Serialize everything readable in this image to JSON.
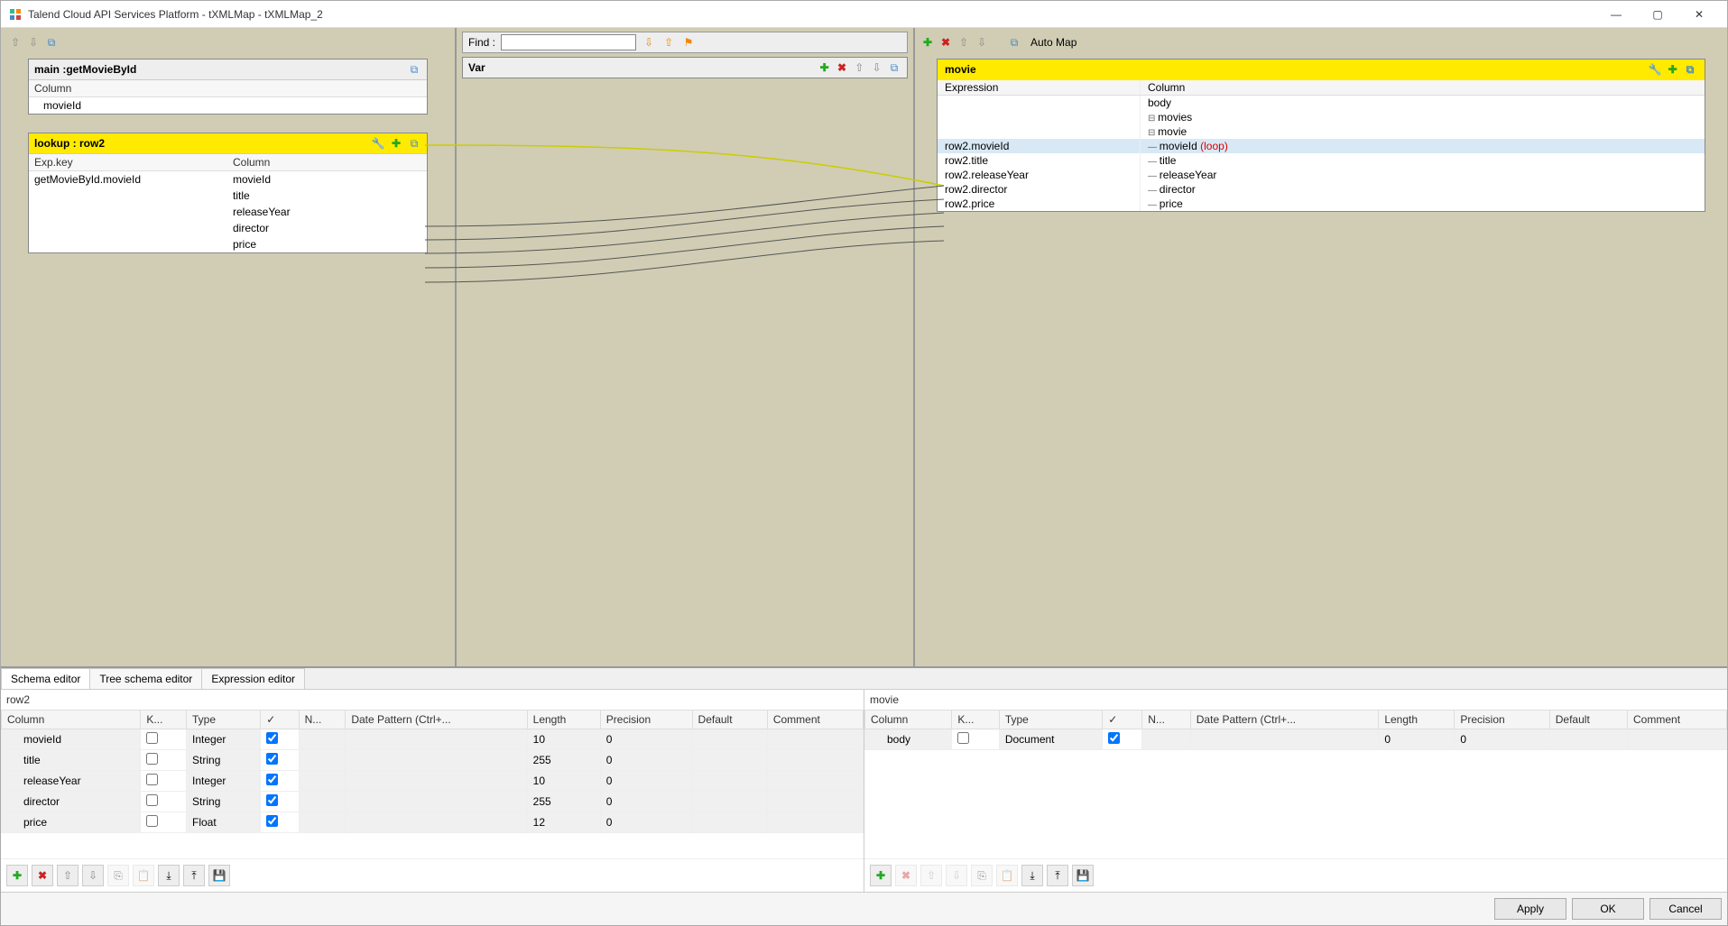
{
  "window": {
    "title": "Talend Cloud API Services Platform - tXMLMap - tXMLMap_2"
  },
  "find": {
    "label": "Find :"
  },
  "var": {
    "title": "Var"
  },
  "mainPanel": {
    "title": "main :getMovieById",
    "colHeader": "Column",
    "rows": [
      "movieId"
    ]
  },
  "lookupPanel": {
    "title": "lookup : row2",
    "expHeader": "Exp.key",
    "colHeader": "Column",
    "rows": [
      {
        "exp": "getMovieById.movieId",
        "col": "movieId"
      },
      {
        "exp": "",
        "col": "title"
      },
      {
        "exp": "",
        "col": "releaseYear"
      },
      {
        "exp": "",
        "col": "director"
      },
      {
        "exp": "",
        "col": "price"
      }
    ]
  },
  "rightToolbar": {
    "autoMap": "Auto Map"
  },
  "output": {
    "title": "movie",
    "expHeader": "Expression",
    "colHeader": "Column",
    "tree": [
      {
        "exp": "",
        "label": "body",
        "indent": 1,
        "type": "plain"
      },
      {
        "exp": "",
        "label": "movies",
        "indent": 2,
        "type": "node"
      },
      {
        "exp": "",
        "label": "movie",
        "indent": 3,
        "type": "node"
      },
      {
        "exp": "row2.movieId",
        "label": "movieId",
        "indent": 4,
        "type": "leaf",
        "loop": "(loop)",
        "sel": true
      },
      {
        "exp": "row2.title",
        "label": "title",
        "indent": 4,
        "type": "leaf"
      },
      {
        "exp": "row2.releaseYear",
        "label": "releaseYear",
        "indent": 4,
        "type": "leaf"
      },
      {
        "exp": "row2.director",
        "label": "director",
        "indent": 4,
        "type": "leaf"
      },
      {
        "exp": "row2.price",
        "label": "price",
        "indent": 4,
        "type": "leaf"
      }
    ]
  },
  "bottomTabs": [
    "Schema editor",
    "Tree schema editor",
    "Expression editor"
  ],
  "schemaLeft": {
    "title": "row2",
    "headers": [
      "Column",
      "K...",
      "Type",
      "✓",
      "N...",
      "Date Pattern (Ctrl+...",
      "Length",
      "Precision",
      "Default",
      "Comment"
    ],
    "rows": [
      {
        "col": "movieId",
        "key": false,
        "type": "Integer",
        "chk": true,
        "n": "",
        "dp": "",
        "len": "10",
        "prec": "0",
        "def": "",
        "cmt": ""
      },
      {
        "col": "title",
        "key": false,
        "type": "String",
        "chk": true,
        "n": "",
        "dp": "",
        "len": "255",
        "prec": "0",
        "def": "",
        "cmt": ""
      },
      {
        "col": "releaseYear",
        "key": false,
        "type": "Integer",
        "chk": true,
        "n": "",
        "dp": "",
        "len": "10",
        "prec": "0",
        "def": "",
        "cmt": ""
      },
      {
        "col": "director",
        "key": false,
        "type": "String",
        "chk": true,
        "n": "",
        "dp": "",
        "len": "255",
        "prec": "0",
        "def": "",
        "cmt": ""
      },
      {
        "col": "price",
        "key": false,
        "type": "Float",
        "chk": true,
        "n": "",
        "dp": "",
        "len": "12",
        "prec": "0",
        "def": "",
        "cmt": ""
      }
    ]
  },
  "schemaRight": {
    "title": "movie",
    "headers": [
      "Column",
      "K...",
      "Type",
      "✓",
      "N...",
      "Date Pattern (Ctrl+...",
      "Length",
      "Precision",
      "Default",
      "Comment"
    ],
    "rows": [
      {
        "col": "body",
        "key": false,
        "type": "Document",
        "chk": true,
        "n": "",
        "dp": "",
        "len": "0",
        "prec": "0",
        "def": "",
        "cmt": ""
      }
    ]
  },
  "buttons": {
    "apply": "Apply",
    "ok": "OK",
    "cancel": "Cancel"
  }
}
